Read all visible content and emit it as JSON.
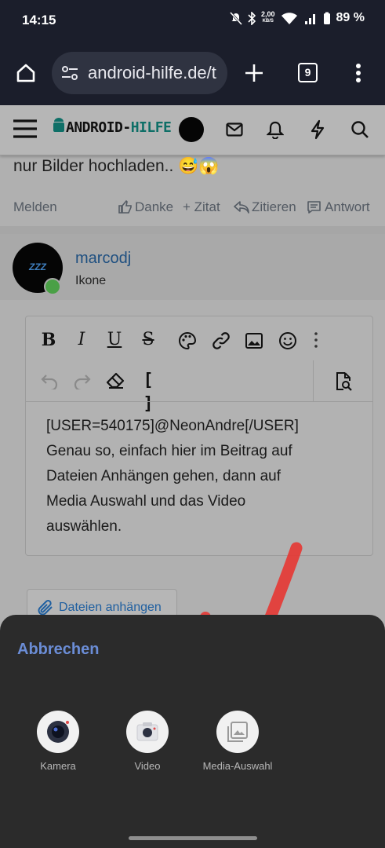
{
  "status_bar": {
    "time": "14:15",
    "net_speed_value": "2,00",
    "net_speed_unit": "KB/S",
    "battery": "89 %"
  },
  "browser": {
    "url": "android-hilfe.de/t",
    "tab_count": "9"
  },
  "site": {
    "logo_left": "ANDROID-",
    "logo_right": "HILFE"
  },
  "post": {
    "text": "nur Bilder hochladen.. 😅😱",
    "actions": {
      "report": "Melden",
      "like": "Danke",
      "quote_add": "+ Zitat",
      "quote": "Zitieren",
      "reply": "Antwort"
    }
  },
  "reply_user": {
    "name": "marcodj",
    "role": "Ikone",
    "avatar_text": "ZZZ"
  },
  "editor": {
    "content_lines": [
      "[USER=540175]@NeonAndre[/USER]",
      "Genau so, einfach hier im Beitrag auf",
      "Dateien Anhängen gehen, dann auf",
      "Media Auswahl und das Video",
      "auswählen."
    ]
  },
  "attach_button": "Dateien anhängen",
  "sheet": {
    "cancel": "Abbrechen",
    "apps": [
      {
        "label": "Kamera",
        "icon": "camera-icon"
      },
      {
        "label": "Video",
        "icon": "video-icon"
      },
      {
        "label": "Media-Auswahl",
        "icon": "gallery-icon"
      }
    ]
  },
  "colors": {
    "status_bar": "#1b1e2b",
    "sheet": "#2b2b2b",
    "link": "#1e4f80",
    "cancel": "#6b8dd6",
    "arrow": "#e53935"
  }
}
